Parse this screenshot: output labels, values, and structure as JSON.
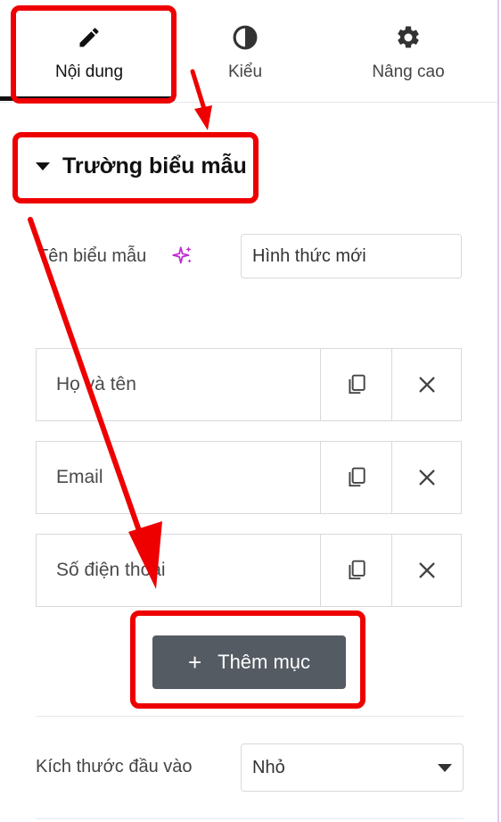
{
  "tabs": [
    {
      "label": "Nội dung",
      "icon": "pencil-icon",
      "active": true
    },
    {
      "label": "Kiểu",
      "icon": "half-circle-icon",
      "active": false
    },
    {
      "label": "Nâng cao",
      "icon": "gear-icon",
      "active": false
    }
  ],
  "section": {
    "title": "Trường biểu mẫu"
  },
  "form_name": {
    "label": "Tên biểu mẫu",
    "value": "Hình thức mới",
    "ai_icon": "sparkle-icon"
  },
  "items": [
    {
      "label": "Họ và tên"
    },
    {
      "label": "Email"
    },
    {
      "label": "Số điện thoại"
    }
  ],
  "add_button": {
    "label": "Thêm mục",
    "icon": "plus-icon"
  },
  "input_size": {
    "label": "Kích thước đầu vào",
    "value": "Nhỏ"
  },
  "colors": {
    "annotation": "#ee0000",
    "button_bg": "#555b63",
    "accent_sparkle": "#c026d3"
  }
}
